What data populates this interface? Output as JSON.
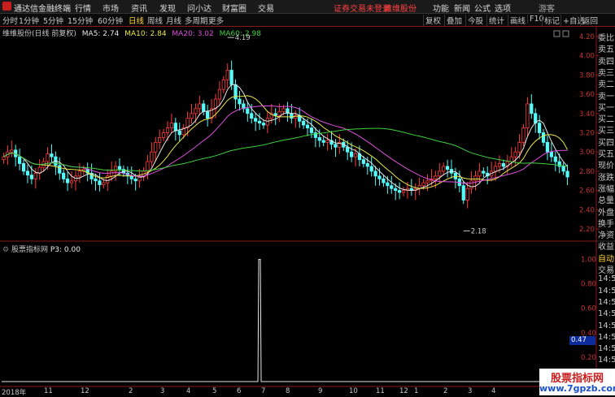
{
  "app": {
    "title": "通达信金融终端",
    "menus": [
      "行情",
      "市场",
      "资讯",
      "发现",
      "问小达",
      "财富圈",
      "交易"
    ],
    "notice": "证券交易未登录",
    "stock_link": "维维股份",
    "right_menus": [
      "功能",
      "新闻",
      "公式",
      "选项"
    ],
    "user": "游客"
  },
  "toolbar": {
    "periods": [
      "分时",
      "1分钟",
      "5分钟",
      "15分钟",
      "60分钟",
      "日线",
      "周线",
      "月线",
      "多周期",
      "更多"
    ],
    "active_period": "日线",
    "tools": [
      "复权",
      "叠加",
      "今股",
      "统计",
      "画线",
      "F10",
      "标记",
      "+自选",
      "返回"
    ]
  },
  "main_legend": {
    "name": "维维股份(日线 前复权)",
    "ma5": "MA5: 2.74",
    "ma10": "MA10: 2.84",
    "ma20": "MA20: 3.02",
    "ma60": "MA60: 2.98",
    "colors": {
      "ma5": "#e8e8e8",
      "ma10": "#e8e84a",
      "ma20": "#e050e0",
      "ma60": "#40d040"
    }
  },
  "annotations": {
    "high": "4.19",
    "low": "2.18"
  },
  "indicator": {
    "name": "股票指标网",
    "p3": "P3: 0.00",
    "readout": "0.47"
  },
  "y_ticks": [
    "4.20",
    "4.00",
    "3.80",
    "3.60",
    "3.40",
    "3.20",
    "3.00",
    "2.80",
    "2.60",
    "2.40",
    "2.20"
  ],
  "ind_ticks": [
    "1.00",
    "0.80",
    "0.60",
    "0.40",
    "0.20"
  ],
  "x_ticks": [
    {
      "label": "2018年"
    },
    {
      "label": "11"
    },
    {
      "label": "12"
    },
    {
      "label": "2"
    },
    {
      "label": "3"
    },
    {
      "label": "4"
    },
    {
      "label": "5"
    },
    {
      "label": "6"
    },
    {
      "label": "7"
    },
    {
      "label": "8"
    },
    {
      "label": "9"
    },
    {
      "label": "10"
    },
    {
      "label": "11"
    },
    {
      "label": "12"
    },
    {
      "label": "1"
    },
    {
      "label": "2"
    },
    {
      "label": "3"
    },
    {
      "label": "4"
    }
  ],
  "side_panel": [
    "委比",
    "卖五",
    "卖四",
    "卖三",
    "卖二",
    "卖一",
    "买一",
    "买二",
    "买三",
    "买四",
    "买五",
    "现价",
    "涨跌",
    "涨幅",
    "总量",
    "外盘",
    "换手",
    "净资",
    "收益",
    "自动",
    "交易",
    "14:5",
    "14:5",
    "14:5",
    "14:5",
    "14:5",
    "14:5",
    "14:5",
    "14:5",
    "14:5",
    "14:5"
  ],
  "watermark": {
    "line1": "股票指标网",
    "line2": "www.7gpzb.com"
  },
  "chart_data": {
    "type": "candlestick",
    "y_range": [
      2.1,
      4.3
    ],
    "indicator_range": [
      0,
      1.05
    ],
    "high_value": 4.19,
    "low_value": 2.18,
    "close": [
      2.95,
      3.0,
      3.02,
      2.95,
      2.88,
      2.8,
      2.76,
      2.72,
      2.78,
      2.84,
      2.9,
      2.98,
      2.95,
      2.86,
      2.78,
      2.72,
      2.68,
      2.7,
      2.75,
      2.8,
      2.82,
      2.78,
      2.72,
      2.7,
      2.66,
      2.68,
      2.75,
      2.8,
      2.85,
      2.82,
      2.78,
      2.75,
      2.72,
      2.7,
      2.74,
      2.8,
      2.9,
      3.0,
      3.1,
      3.15,
      3.2,
      3.25,
      3.3,
      3.22,
      3.18,
      3.25,
      3.35,
      3.4,
      3.45,
      3.5,
      3.42,
      3.35,
      3.45,
      3.55,
      3.65,
      3.75,
      3.85,
      3.7,
      3.55,
      3.5,
      3.45,
      3.4,
      3.35,
      3.32,
      3.3,
      3.28,
      3.35,
      3.4,
      3.38,
      3.42,
      3.45,
      3.4,
      3.35,
      3.38,
      3.32,
      3.28,
      3.25,
      3.2,
      3.15,
      3.12,
      3.1,
      3.12,
      3.08,
      3.05,
      3.1,
      3.05,
      3.0,
      2.95,
      2.98,
      2.92,
      2.88,
      2.85,
      2.8,
      2.75,
      2.72,
      2.68,
      2.65,
      2.62,
      2.6,
      2.58,
      2.6,
      2.62,
      2.6,
      2.62,
      2.65,
      2.68,
      2.7,
      2.72,
      2.75,
      2.8,
      2.85,
      2.82,
      2.78,
      2.72,
      2.65,
      2.5,
      2.62,
      2.7,
      2.75,
      2.8,
      2.78,
      2.75,
      2.8,
      2.85,
      2.88,
      2.85,
      2.9,
      2.95,
      3.0,
      3.1,
      3.25,
      3.5,
      3.4,
      3.3,
      3.2,
      3.1,
      3.0,
      2.95,
      2.9,
      2.85,
      2.8,
      2.74
    ],
    "indicator_values_spike_index": 64,
    "indicator_spike_value": 1.0
  }
}
